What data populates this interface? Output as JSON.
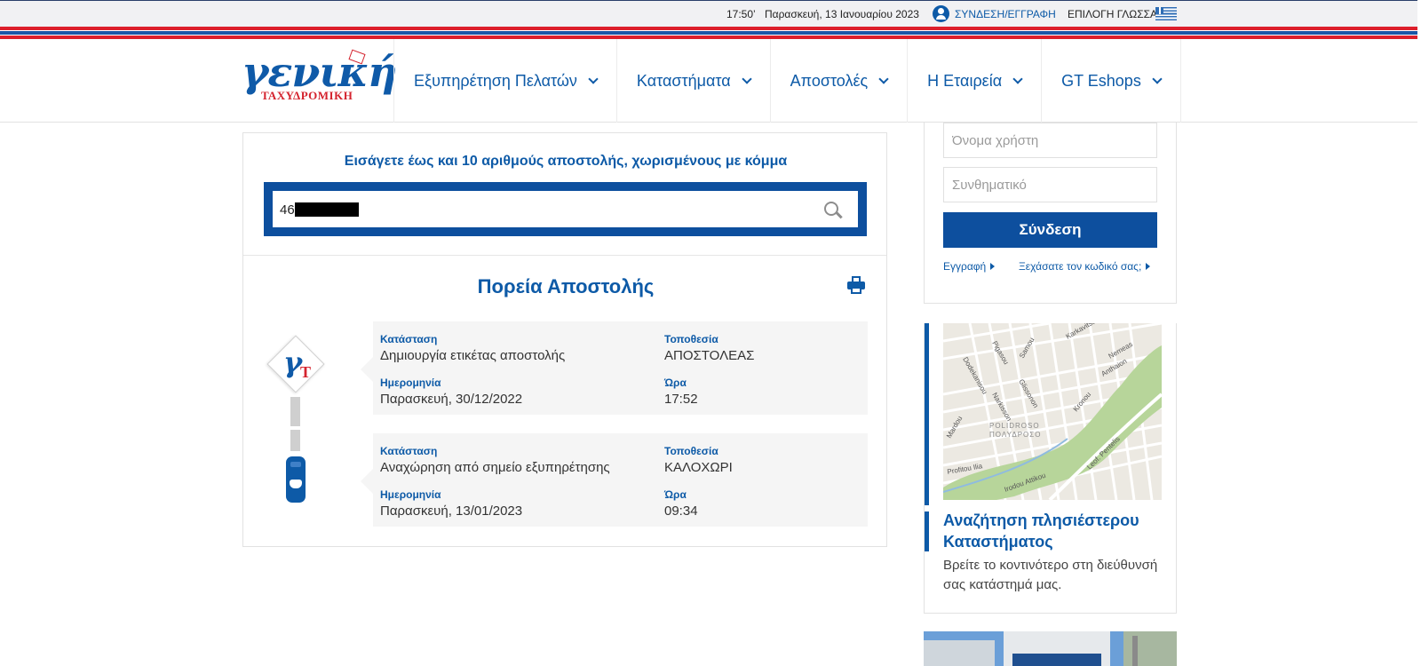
{
  "topbar": {
    "time": "17:50’",
    "date": "Παρασκευή, 13 Ιανουαρίου 2023",
    "login_link": "ΣΥΝΔΕΣΗ/ΕΓΓΡΑΦΗ",
    "language_label": "ΕΠΙΛΟΓΗ ΓΛΩΣΣΑΣ:"
  },
  "logo": {
    "word": "γενική",
    "sub": "ΤΑΧΥΔΡΟΜΙΚΗ"
  },
  "nav": {
    "items": [
      {
        "label": "Εξυπηρέτηση Πελατών"
      },
      {
        "label": "Καταστήματα"
      },
      {
        "label": "Αποστολές"
      },
      {
        "label": "Η Εταιρεία"
      },
      {
        "label": "GT Eshops"
      }
    ]
  },
  "tracking": {
    "prompt": "Εισάγετε έως και 10 αριθμούς αποστολής, χωρισμένους με κόμμα",
    "input_value": "46",
    "route_title": "Πορεία Αποστολής",
    "labels": {
      "status": "Κατάσταση",
      "location": "Τοποθεσία",
      "date": "Ημερομηνία",
      "time": "Ώρα"
    },
    "events": [
      {
        "status": "Δημιουργία ετικέτας αποστολής",
        "location": "ΑΠΟΣΤΟΛΕΑΣ",
        "date": "Παρασκευή, 30/12/2022",
        "time": "17:52"
      },
      {
        "status": "Αναχώρηση από σημείο εξυπηρέτησης",
        "location": "ΚΑΛΟΧΩΡΙ",
        "date": "Παρασκευή, 13/01/2023",
        "time": "09:34"
      }
    ]
  },
  "login_panel": {
    "username_placeholder": "Όνομα χρήστη",
    "password_placeholder": "Συνθηματικό",
    "submit_label": "Σύνδεση",
    "register_link": "Εγγραφή",
    "forgot_link": "Ξεχάσατε τον κωδικό σας;"
  },
  "store_finder": {
    "title": "Αναζήτηση πλησιέστερου Καταστήματος",
    "description": "Βρείτε το κοντινότερο στη διεύθυνσή σας κατάστημά μας."
  },
  "map_labels": {
    "karkavitsa": "Karkavitsa",
    "pigasou": "Pigasou",
    "dodekanisou": "Dodekanisou",
    "anthaion": "Anthaion",
    "nemeas": "Nemeas",
    "samou": "Samou",
    "narkisson": "Narkisson",
    "glissonon": "Glissonon",
    "kronou": "Kronou",
    "mardou": "Mardou",
    "polidroso": "POLIDROSO",
    "polidroso_gr": "ΠΟΛΥΔΡΟΣΟ",
    "pentelis": "Leof. Pentelis",
    "profitou": "Profitou Ilia",
    "irodou": "Irodou Attikou"
  },
  "colors": {
    "brand_blue": "#0d5aa7",
    "dark_blue": "#0d4f9e",
    "brand_red": "#d4232e",
    "card_bg": "#f5f5f5"
  }
}
